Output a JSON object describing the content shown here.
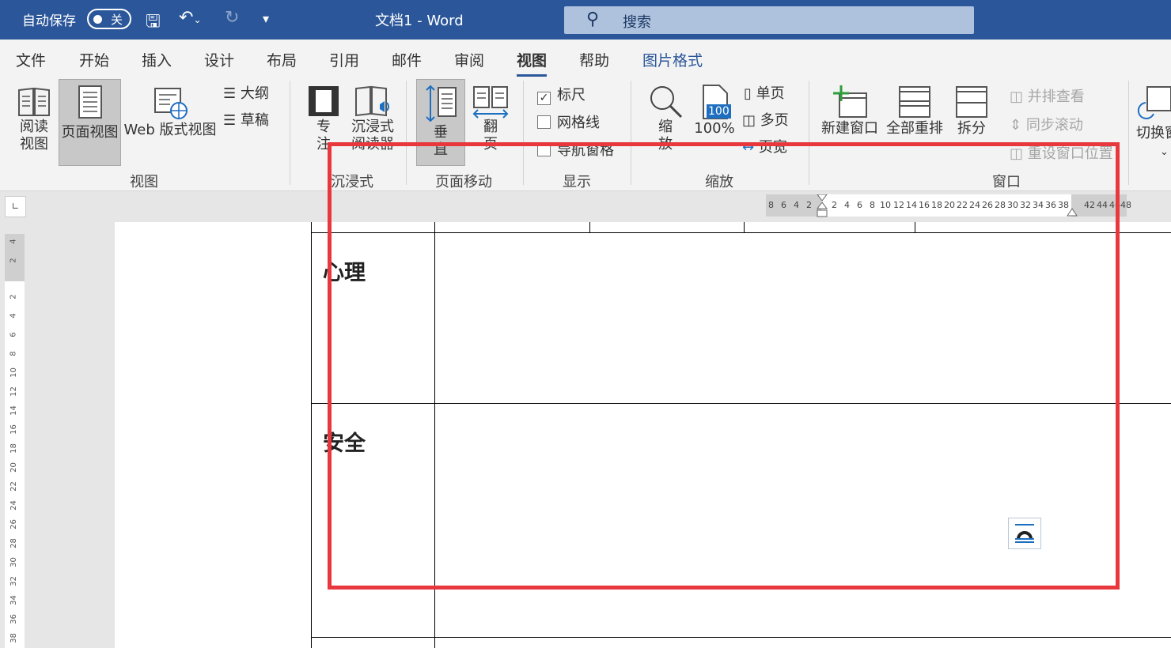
{
  "titlebar": {
    "autosave_label": "自动保存",
    "autosave_state": "关",
    "doc_title": "文档1  -  Word",
    "search_text": "搜索",
    "bg_color": "#2b579a"
  },
  "tabs": [
    "文件",
    "开始",
    "插入",
    "设计",
    "布局",
    "引用",
    "邮件",
    "审阅",
    "视图",
    "帮助",
    "图片格式"
  ],
  "active_tab": "视图",
  "ribbon": {
    "views": {
      "read_line1": "阅读",
      "read_line2": "视图",
      "print_layout": "页面视图",
      "web_layout": "Web 版式视图",
      "outline": "大纲",
      "draft": "草稿",
      "group": "视图"
    },
    "immersive": {
      "focus_line1": "专",
      "focus_line2": "注",
      "reader_line1": "沉浸式",
      "reader_line2": "阅读器",
      "group": "沉浸式"
    },
    "page_movement": {
      "vertical_line1": "垂",
      "vertical_line2": "直",
      "side_line1": "翻",
      "side_line2": "页",
      "group": "页面移动"
    },
    "show": {
      "ruler": "标尺",
      "gridlines": "网格线",
      "nav_pane": "导航窗格",
      "group": "显示"
    },
    "zoom": {
      "zoom_line1": "缩",
      "zoom_line2": "放",
      "percent_badge": "100",
      "percent": "100%",
      "one_page": "单页",
      "multiple_pages": "多页",
      "page_width": "页宽",
      "group": "缩放"
    },
    "window": {
      "new_window": "新建窗口",
      "arrange_all": "全部重排",
      "split": "拆分",
      "side_by_side": "并排查看",
      "sync_scroll": "同步滚动",
      "reset_position": "重设窗口位置",
      "switch_windows": "切换窗",
      "group": "窗口"
    }
  },
  "h_ruler_numbers": [
    "8",
    "6",
    "4",
    "2",
    "2",
    "4",
    "6",
    "8",
    "10",
    "12",
    "14",
    "16",
    "18",
    "20",
    "22",
    "24",
    "26",
    "28",
    "30",
    "32",
    "34",
    "36",
    "38",
    "42",
    "44",
    "46",
    "48"
  ],
  "v_ruler_numbers": [
    "4",
    "2",
    "2",
    "4",
    "6",
    "8",
    "10",
    "12",
    "14",
    "16",
    "18",
    "20",
    "22",
    "24",
    "26",
    "28",
    "30",
    "32",
    "34",
    "36",
    "38"
  ],
  "document": {
    "row1_label": "心理",
    "row2_label": "安全"
  },
  "highlight_color": "#e8383d"
}
